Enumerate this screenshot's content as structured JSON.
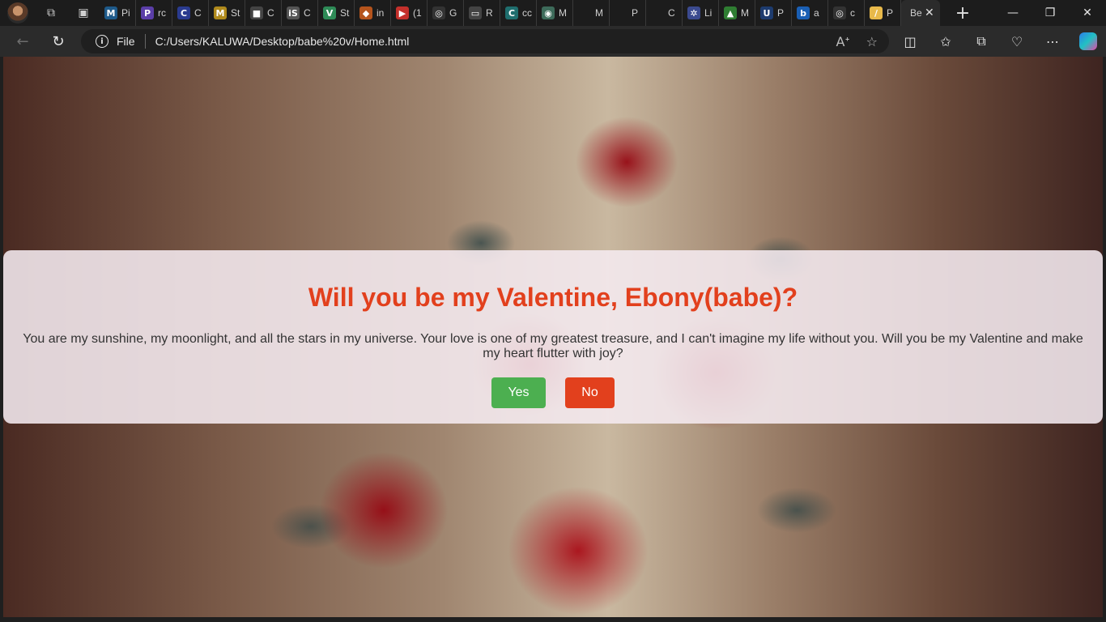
{
  "browser": {
    "tabs": [
      {
        "fav": "M",
        "title": "Pi",
        "color": "#1e5a8a"
      },
      {
        "fav": "P",
        "title": "rc",
        "color": "#5b3ea8"
      },
      {
        "fav": "C",
        "title": "C",
        "color": "#2a3b8f"
      },
      {
        "fav": "M",
        "title": "St",
        "color": "#b08a1c"
      },
      {
        "fav": "■",
        "title": "C",
        "color": "#444444"
      },
      {
        "fav": "iS",
        "title": "C",
        "color": "#555555"
      },
      {
        "fav": "V",
        "title": "St",
        "color": "#2e8b57"
      },
      {
        "fav": "◆",
        "title": "in",
        "color": "#b5541c"
      },
      {
        "fav": "▶",
        "title": "(1",
        "color": "#c4302b"
      },
      {
        "fav": "◎",
        "title": "G",
        "color": "#333333"
      },
      {
        "fav": "▭",
        "title": "R",
        "color": "#444444"
      },
      {
        "fav": "C",
        "title": "cc",
        "color": "#1f6e6e"
      },
      {
        "fav": "◉",
        "title": "M",
        "color": "#3d6b5a"
      },
      {
        "fav": "",
        "title": "M",
        "color": "#1c1c1c"
      },
      {
        "fav": "",
        "title": "P",
        "color": "#1c1c1c"
      },
      {
        "fav": "",
        "title": "C",
        "color": "#1c1c1c"
      },
      {
        "fav": "✲",
        "title": "Li",
        "color": "#3b4a8f"
      },
      {
        "fav": "▲",
        "title": "M",
        "color": "#2f7d32"
      },
      {
        "fav": "U",
        "title": "P",
        "color": "#1d3b6e"
      },
      {
        "fav": "b",
        "title": "a",
        "color": "#1a5fb4"
      },
      {
        "fav": "◎",
        "title": "c",
        "color": "#333333"
      },
      {
        "fav": "/",
        "title": "P",
        "color": "#e8b94a"
      }
    ],
    "active_tab": {
      "fav": "",
      "title": "Be"
    },
    "new_tab_symbol": "+",
    "file_label": "File",
    "url": "C:/Users/KALUWA/Desktop/babe%20v/Home.html"
  },
  "page": {
    "heading": "Will you be my Valentine, Ebony(babe)?",
    "message": "You are my sunshine, my moonlight, and all the stars in my universe. Your love is one of my greatest treasure, and I can't imagine my life without you. Will you be my Valentine and make my heart flutter with joy?",
    "yes_label": "Yes",
    "no_label": "No",
    "colors": {
      "heading": "#e2401d",
      "yes": "#4caf50",
      "no": "#e2401d"
    }
  }
}
